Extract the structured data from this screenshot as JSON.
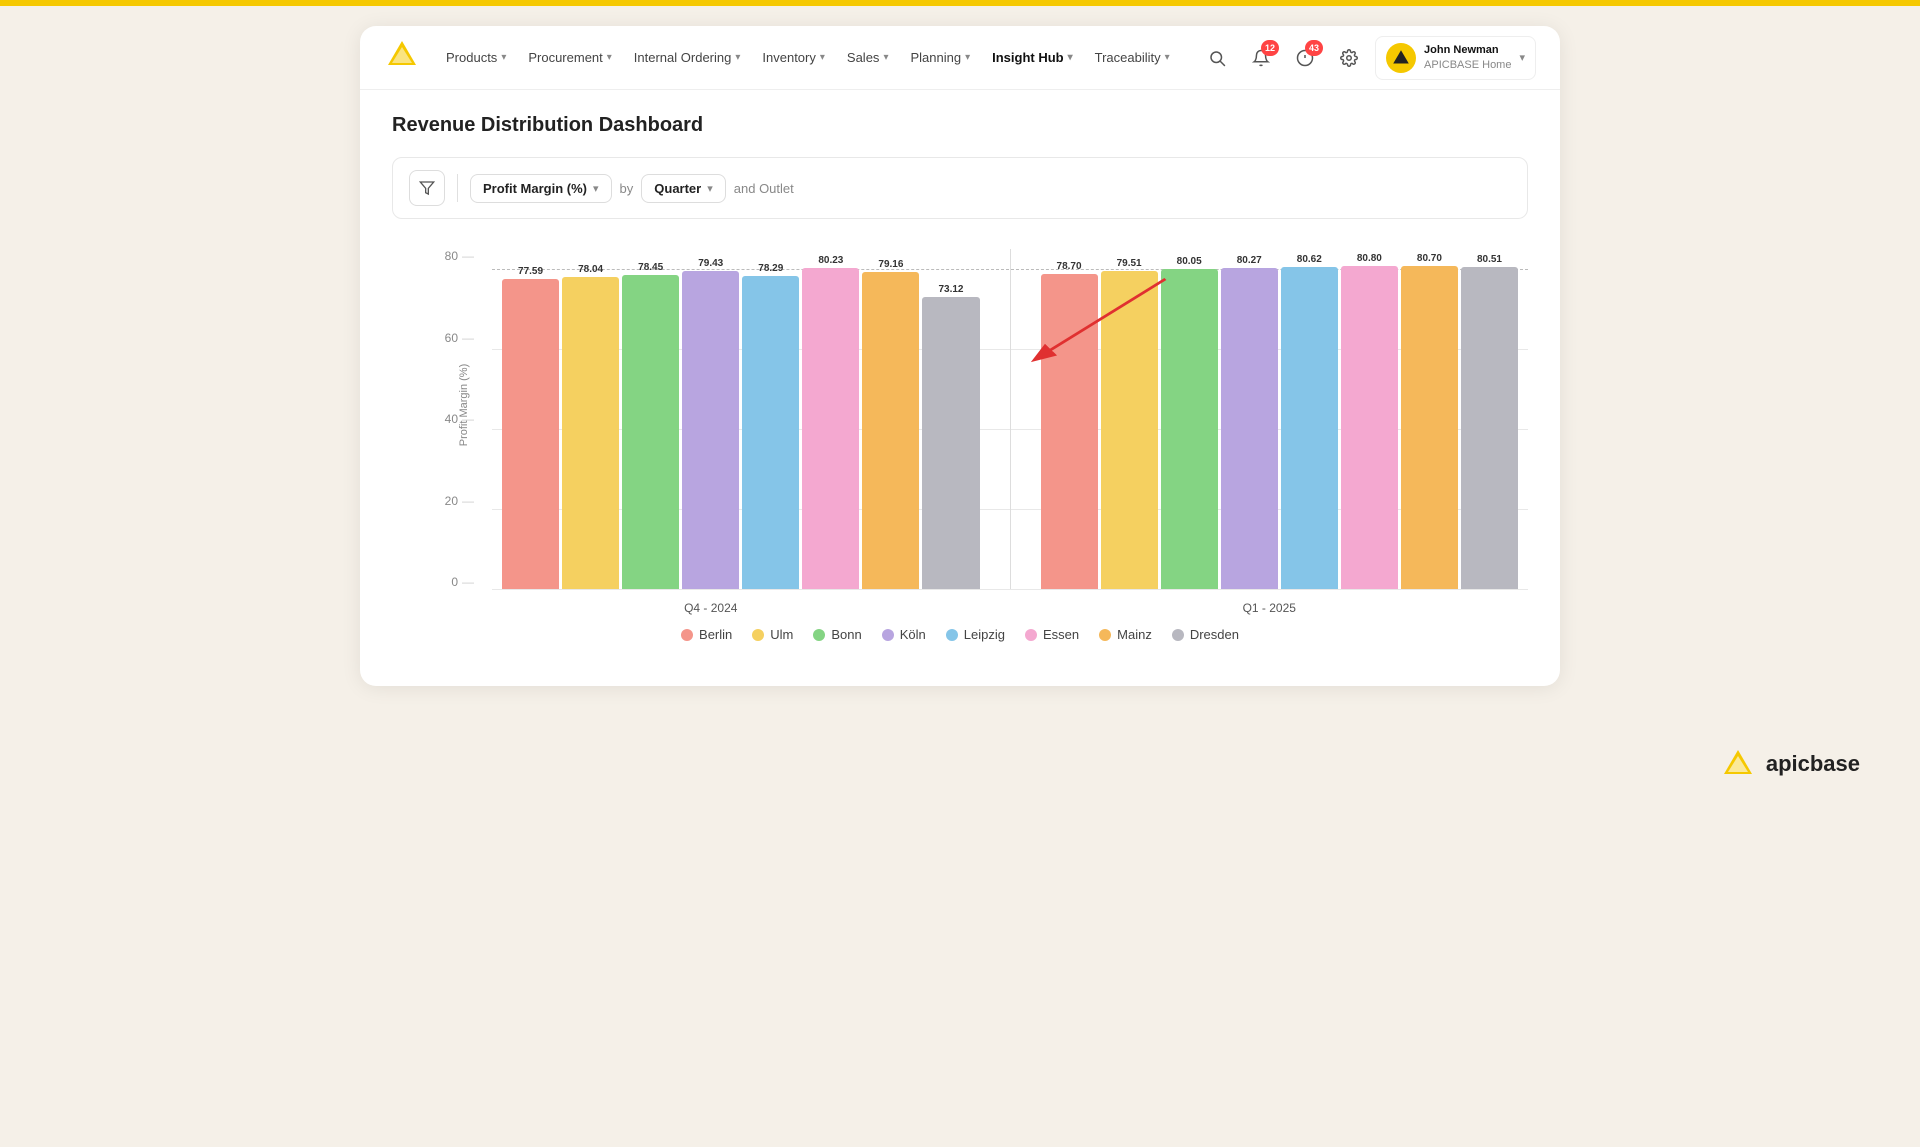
{
  "topBar": {
    "color": "#f5c800"
  },
  "navbar": {
    "logoAlt": "Apicbase Logo",
    "items": [
      {
        "label": "Products",
        "active": false,
        "hasDropdown": true
      },
      {
        "label": "Procurement",
        "active": false,
        "hasDropdown": true
      },
      {
        "label": "Internal Ordering",
        "active": false,
        "hasDropdown": true
      },
      {
        "label": "Inventory",
        "active": false,
        "hasDropdown": true
      },
      {
        "label": "Sales",
        "active": false,
        "hasDropdown": true
      },
      {
        "label": "Planning",
        "active": false,
        "hasDropdown": true
      },
      {
        "label": "Insight Hub",
        "active": true,
        "hasDropdown": true
      },
      {
        "label": "Traceability",
        "active": false,
        "hasDropdown": true
      }
    ],
    "notificationBadge1": "12",
    "notificationBadge2": "43",
    "userName": "John Newman",
    "userOrg": "APICBASE Home"
  },
  "page": {
    "title": "Revenue Distribution Dashboard"
  },
  "filterBar": {
    "metric": "Profit Margin (%)",
    "byLabel": "by",
    "period": "Quarter",
    "andLabel": "and Outlet"
  },
  "chart": {
    "yAxisTitle": "Profit Margin (%)",
    "yLabels": [
      "0",
      "20",
      "40",
      "60",
      "80"
    ],
    "dottedLineValue": 80,
    "groups": [
      {
        "label": "Q4 - 2024",
        "bars": [
          {
            "city": "Berlin",
            "value": 77.59,
            "color": "#f4958a"
          },
          {
            "city": "Ulm",
            "value": 78.04,
            "color": "#f5d060"
          },
          {
            "city": "Bonn",
            "value": 78.45,
            "color": "#84d483"
          },
          {
            "city": "Köln",
            "value": 79.43,
            "color": "#b8a5e0"
          },
          {
            "city": "Leipzig",
            "value": 78.29,
            "color": "#85c5e8"
          },
          {
            "city": "Essen",
            "value": 80.23,
            "color": "#f4a8d0"
          },
          {
            "city": "Mainz",
            "value": 79.16,
            "color": "#f5b85a"
          },
          {
            "city": "Dresden",
            "value": 73.12,
            "color": "#b8b8c0"
          }
        ]
      },
      {
        "label": "Q1 - 2025",
        "bars": [
          {
            "city": "Berlin",
            "value": 78.7,
            "color": "#f4958a"
          },
          {
            "city": "Ulm",
            "value": 79.51,
            "color": "#f5d060"
          },
          {
            "city": "Bonn",
            "value": 80.05,
            "color": "#84d483"
          },
          {
            "city": "Köln",
            "value": 80.27,
            "color": "#b8a5e0"
          },
          {
            "city": "Leipzig",
            "value": 80.62,
            "color": "#85c5e8"
          },
          {
            "city": "Essen",
            "value": 80.8,
            "color": "#f4a8d0"
          },
          {
            "city": "Mainz",
            "value": 80.7,
            "color": "#f5b85a"
          },
          {
            "city": "Dresden",
            "value": 80.51,
            "color": "#b8b8c0"
          }
        ]
      }
    ],
    "legend": [
      {
        "city": "Berlin",
        "color": "#f4958a"
      },
      {
        "city": "Ulm",
        "color": "#f5d060"
      },
      {
        "city": "Bonn",
        "color": "#84d483"
      },
      {
        "city": "Köln",
        "color": "#b8a5e0"
      },
      {
        "city": "Leipzig",
        "color": "#85c5e8"
      },
      {
        "city": "Essen",
        "color": "#f4a8d0"
      },
      {
        "city": "Mainz",
        "color": "#f5b85a"
      },
      {
        "city": "Dresden",
        "color": "#b8b8c0"
      }
    ],
    "maxValue": 85,
    "arrow": {
      "x1pct": 60,
      "y1pct": 8,
      "x2pct": 52,
      "y2pct": 30
    }
  },
  "bottomLogo": {
    "text": "apicbase"
  }
}
